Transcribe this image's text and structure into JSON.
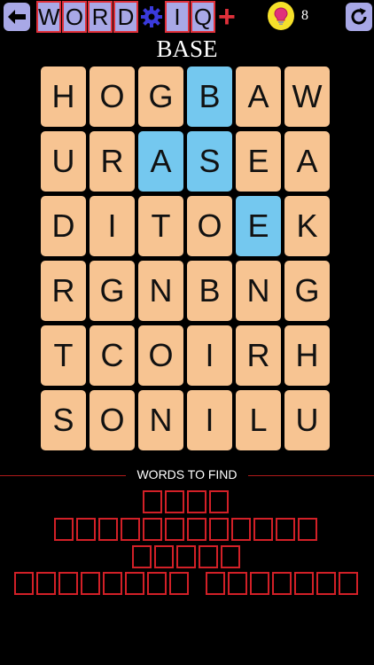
{
  "header": {
    "logo_letters": [
      "W",
      "O",
      "R",
      "D",
      "",
      "I",
      "Q"
    ],
    "logo_plus": "+",
    "hint_count": "8",
    "current_word": "BASE"
  },
  "colors": {
    "background": "#000000",
    "tile": "#f7c492",
    "tile_selected": "#74c8ef",
    "button": "#a8a8e6",
    "accent_red": "#d22027",
    "bulb": "#f6e02a"
  },
  "icons": {
    "back": "back-arrow-icon",
    "gear": "gear-icon",
    "hint": "lightbulb-icon",
    "refresh": "refresh-icon"
  },
  "grid": [
    [
      {
        "l": "H"
      },
      {
        "l": "O"
      },
      {
        "l": "G"
      },
      {
        "l": "B",
        "sel": true
      },
      {
        "l": "A"
      },
      {
        "l": "W"
      }
    ],
    [
      {
        "l": "U"
      },
      {
        "l": "R"
      },
      {
        "l": "A",
        "sel": true
      },
      {
        "l": "S",
        "sel": true
      },
      {
        "l": "E"
      },
      {
        "l": "A"
      }
    ],
    [
      {
        "l": "D"
      },
      {
        "l": "I"
      },
      {
        "l": "T"
      },
      {
        "l": "O"
      },
      {
        "l": "E",
        "sel": true
      },
      {
        "l": "K"
      }
    ],
    [
      {
        "l": "R"
      },
      {
        "l": "G"
      },
      {
        "l": "N"
      },
      {
        "l": "B"
      },
      {
        "l": "N"
      },
      {
        "l": "G"
      }
    ],
    [
      {
        "l": "T"
      },
      {
        "l": "C"
      },
      {
        "l": "O"
      },
      {
        "l": "I"
      },
      {
        "l": "R"
      },
      {
        "l": "H"
      }
    ],
    [
      {
        "l": "S"
      },
      {
        "l": "O"
      },
      {
        "l": "N"
      },
      {
        "l": "I"
      },
      {
        "l": "L"
      },
      {
        "l": "U"
      }
    ]
  ],
  "words_to_find": {
    "label": "WORDS TO FIND",
    "rows": [
      [
        4
      ],
      [
        12
      ],
      [
        5
      ],
      [
        8,
        7
      ]
    ]
  }
}
